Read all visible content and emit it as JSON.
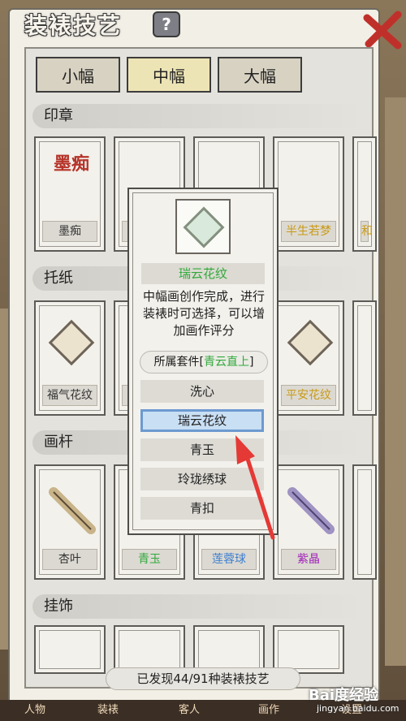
{
  "title": "装裱技艺",
  "help_glyph": "?",
  "size_tabs": [
    {
      "label": "小幅",
      "active": false
    },
    {
      "label": "中幅",
      "active": true
    },
    {
      "label": "大幅",
      "active": false
    }
  ],
  "sections": {
    "seal": "印章",
    "paper": "托纸",
    "rod": "画杆",
    "ornament": "挂饰"
  },
  "seal_cards": [
    {
      "label": "墨痴",
      "art": "墨痴",
      "color": "#333333"
    },
    {
      "label": "",
      "art": "",
      "color": "#333333"
    },
    {
      "label": "",
      "art": "",
      "color": "#333333"
    },
    {
      "label": "半生若梦",
      "art": "",
      "color": "#c99a16"
    },
    {
      "label": "和",
      "art": "",
      "color": "#c99a16"
    }
  ],
  "paper_cards": [
    {
      "label": "福气花纹",
      "color": "#333333"
    },
    {
      "label": "",
      "color": "#333333"
    },
    {
      "label": "",
      "color": "#333333"
    },
    {
      "label": "平安花纹",
      "color": "#c99a16"
    }
  ],
  "rod_cards": [
    {
      "label": "杏叶",
      "color": "#333333"
    },
    {
      "label": "青玉",
      "color": "#2fa93a"
    },
    {
      "label": "莲蓉球",
      "color": "#3d7fd0"
    },
    {
      "label": "紫晶",
      "color": "#a023b8"
    }
  ],
  "popup": {
    "name": "瑞云花纹",
    "description": "中幅画创作完成，进行装裱时可选择，可以增加画作评分",
    "suite_prefix": "所属套件[",
    "suite_name": "青云直上",
    "suite_suffix": "]",
    "options": [
      {
        "label": "洗心",
        "selected": false
      },
      {
        "label": "瑞云花纹",
        "selected": true
      },
      {
        "label": "青玉",
        "selected": false
      },
      {
        "label": "玲珑绣球",
        "selected": false
      },
      {
        "label": "青扣",
        "selected": false
      }
    ]
  },
  "footer": {
    "discovered_text": "已发现44/91种装裱技艺"
  },
  "bottom_nav": [
    "人物",
    "装裱",
    "客人",
    "画作",
    "设置"
  ],
  "watermark": {
    "brand": "Bai度经验",
    "url": "jingyan.baidu.com"
  },
  "colors": {
    "accent_green": "#2fa93a",
    "accent_gold": "#c99a16",
    "accent_blue": "#3d7fd0",
    "accent_purple": "#a023b8",
    "arrow_red": "#e53935"
  }
}
